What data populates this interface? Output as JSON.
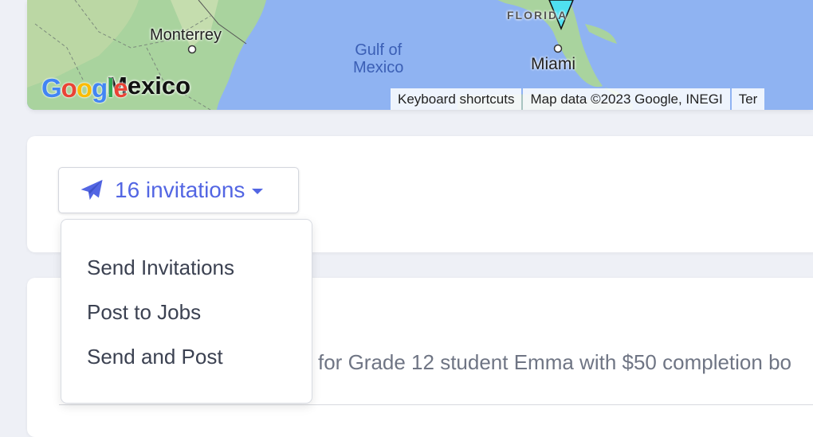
{
  "map": {
    "labels": {
      "monterrey": "Monterrey",
      "gulf_line1": "Gulf of",
      "gulf_line2": "Mexico",
      "florida": "FLORIDA",
      "miami": "Miami",
      "mexico": "Mexico"
    },
    "logo": {
      "letters": [
        "G",
        "o",
        "o",
        "g",
        "l",
        "e"
      ],
      "colors": [
        "#4285f4",
        "#ea4335",
        "#fbbc05",
        "#4285f4",
        "#34a853",
        "#ea4335"
      ]
    },
    "attribution": [
      "Keyboard shortcuts",
      "Map data ©2023 Google, INEGI",
      "Ter"
    ],
    "water_color": "#8fb3f2",
    "land_color": "#a9d39e"
  },
  "invitations": {
    "button_label": "16 invitations",
    "icon": "paper-plane-icon",
    "accent_color": "#5366e3",
    "menu": [
      "Send Invitations",
      "Post to Jobs",
      "Send and Post"
    ]
  },
  "main": {
    "description": "for Grade 12 student Emma with $50 completion bo"
  }
}
